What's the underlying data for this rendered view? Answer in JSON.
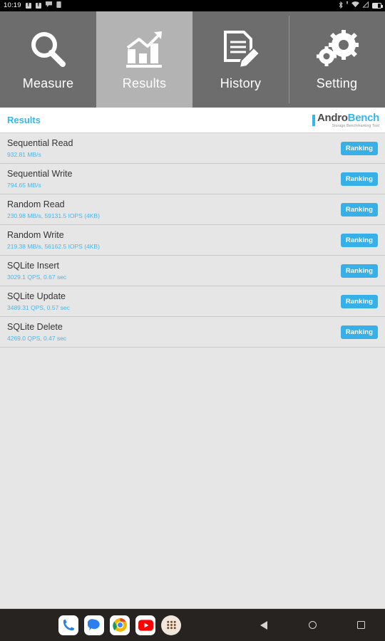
{
  "statusbar": {
    "clock": "10:19",
    "left_icons": [
      "facebook-icon",
      "facebook-icon",
      "messenger-icon",
      "note-icon"
    ],
    "right_icons": [
      "bluetooth-icon",
      "alarm-icon",
      "wifi-icon",
      "signal-icon",
      "battery-icon"
    ],
    "bluetooth_glyph": "✶",
    "wifi_glyph": "▼",
    "signal_glyph": "◢"
  },
  "tabs": [
    {
      "label": "Measure",
      "icon": "magnifier-icon",
      "active": false
    },
    {
      "label": "Results",
      "icon": "bar-chart-icon",
      "active": true
    },
    {
      "label": "History",
      "icon": "document-pencil-icon",
      "active": false
    },
    {
      "label": "Setting",
      "icon": "gears-icon",
      "active": false
    }
  ],
  "header": {
    "title": "Results",
    "logo_primary": "Andro",
    "logo_secondary": "Bench",
    "logo_tagline": "Storage Benchmarking Tool"
  },
  "results": {
    "ranking_label": "Ranking",
    "rows": [
      {
        "name": "Sequential Read",
        "value": "932.81 MB/s"
      },
      {
        "name": "Sequential Write",
        "value": "794.65 MB/s"
      },
      {
        "name": "Random Read",
        "value": "230.98 MB/s, 59131.5 IOPS (4KB)"
      },
      {
        "name": "Random Write",
        "value": "219.38 MB/s, 56162.5 IOPS (4KB)"
      },
      {
        "name": "SQLite Insert",
        "value": "3029.1 QPS, 0.67 sec"
      },
      {
        "name": "SQLite Update",
        "value": "3489.31 QPS, 0.57 sec"
      },
      {
        "name": "SQLite Delete",
        "value": "4269.0 QPS, 0.47 sec"
      }
    ]
  },
  "navbar": {
    "apps": [
      {
        "name": "phone-app-icon"
      },
      {
        "name": "messages-app-icon"
      },
      {
        "name": "chrome-app-icon"
      },
      {
        "name": "youtube-app-icon"
      },
      {
        "name": "app-drawer-icon"
      }
    ],
    "keys": [
      "back-button",
      "home-button",
      "recents-button"
    ]
  },
  "colors": {
    "accent": "#36b0e6",
    "tab_inactive": "#6d6d6d",
    "tab_active": "#b3b3b3",
    "list_bg": "#e6e6e6"
  }
}
